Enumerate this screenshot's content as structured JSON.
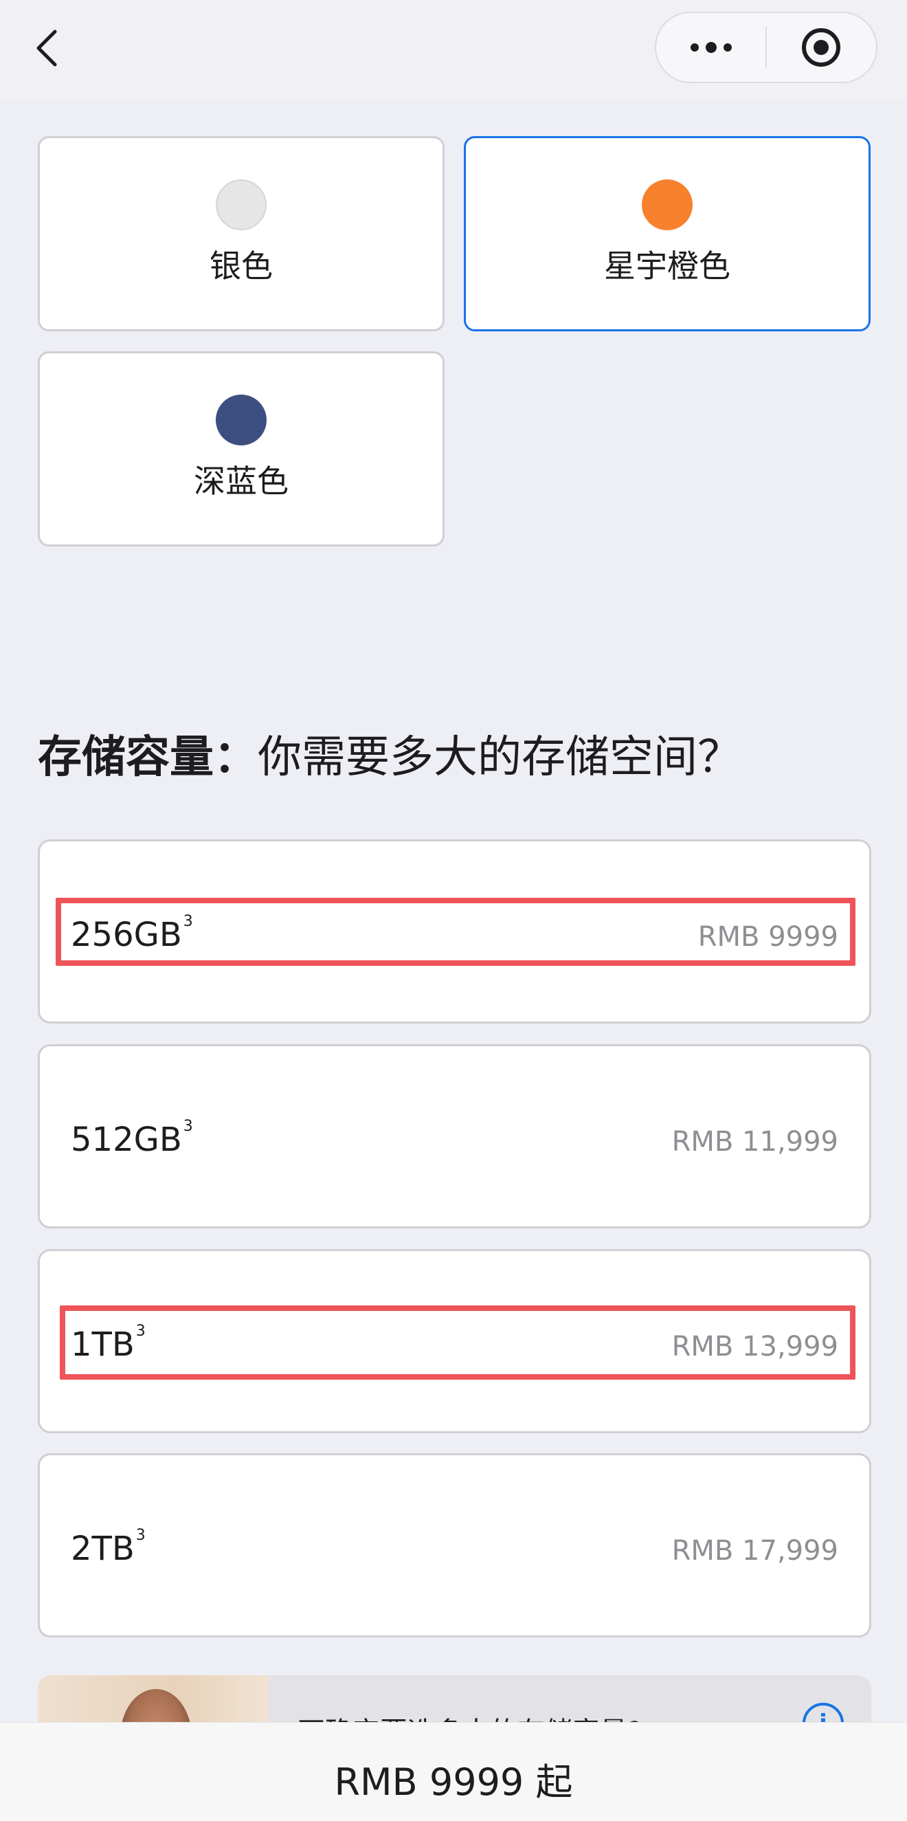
{
  "nav": {
    "back_icon": "chevron-left-icon",
    "more_icon": "more-dots-icon",
    "record_icon": "target-icon"
  },
  "colors": [
    {
      "label": "银色",
      "swatch": "#e6e6e6",
      "selected": false
    },
    {
      "label": "星宇橙色",
      "swatch": "#f7812d",
      "selected": true
    },
    {
      "label": "深蓝色",
      "swatch": "#3d4f80",
      "selected": false
    }
  ],
  "storage": {
    "heading_bold": "存储容量：",
    "heading_rest": "你需要多大的存储空间？",
    "options": [
      {
        "size": "256GB",
        "note": "3",
        "price": "RMB 9999"
      },
      {
        "size": "512GB",
        "note": "3",
        "price": "RMB 11,999"
      },
      {
        "size": "1TB",
        "note": "3",
        "price": "RMB 13,999"
      },
      {
        "size": "2TB",
        "note": "3",
        "price": "RMB 17,999"
      }
    ]
  },
  "help_banner": {
    "text": "不确定要选多大的存储容量?",
    "icon": "info-icon"
  },
  "bottom": {
    "price": "RMB 9999 起"
  },
  "accent_colors": {
    "selected_border": "#1a73e8",
    "highlight": "#ef5459"
  }
}
